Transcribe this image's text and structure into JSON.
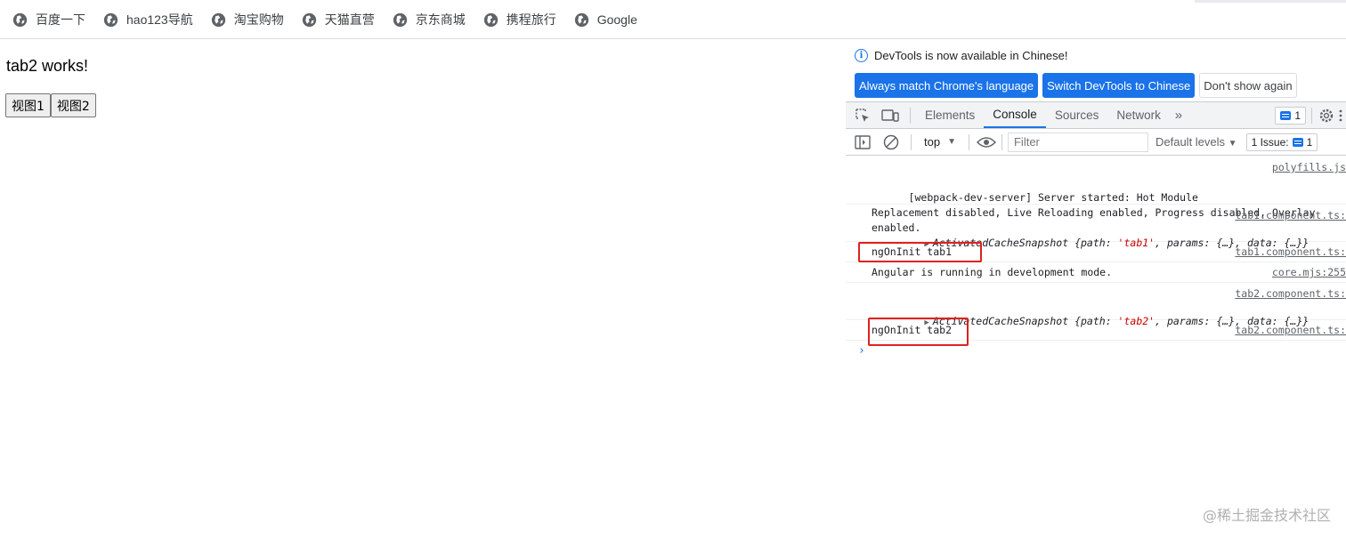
{
  "bookmarks": [
    {
      "label": "百度一下"
    },
    {
      "label": "hao123导航"
    },
    {
      "label": "淘宝购物"
    },
    {
      "label": "天猫直营"
    },
    {
      "label": "京东商城"
    },
    {
      "label": "携程旅行"
    },
    {
      "label": "Google"
    }
  ],
  "page": {
    "title": "tab2 works!",
    "buttons": [
      "视图1",
      "视图2"
    ]
  },
  "devtools": {
    "info_message": "DevTools is now available in Chinese!",
    "lang_buttons": {
      "always_match": "Always match Chrome's language",
      "switch": "Switch DevTools to Chinese",
      "dont_show": "Don't show again"
    },
    "tabs": [
      "Elements",
      "Console",
      "Sources",
      "Network"
    ],
    "active_tab": "Console",
    "messages_badge": "1",
    "context": "top",
    "filter_placeholder": "Filter",
    "levels": "Default levels",
    "issues": {
      "label": "1 Issue:",
      "count": "1"
    },
    "console_messages": [
      {
        "text": "[webpack-dev-server] Server started: Hot Module\nReplacement disabled, Live Reloading enabled, Progress disabled, Overlay\nenabled.",
        "source": "polyfills.js"
      },
      {
        "object_type": "ActivatedCacheSnapshot",
        "object_body_1": "{path: ",
        "path": "'tab1'",
        "object_body_2": ", params: {…}, data: {…}}",
        "source": "tab1.component.ts:"
      },
      {
        "text": "ngOnInit tab1",
        "source": "tab1.component.ts:",
        "highlighted": true
      },
      {
        "text": "Angular is running in development mode.",
        "source": "core.mjs:255"
      },
      {
        "object_type": "ActivatedCacheSnapshot",
        "object_body_1": "{path: ",
        "path": "'tab2'",
        "object_body_2": ", params: {…}, data: {…}}",
        "source": "tab2.component.ts:"
      },
      {
        "text": "ngOnInit tab2",
        "source": "tab2.component.ts:",
        "highlighted": true
      }
    ],
    "highlight_color": "#e0201d"
  },
  "watermark": "@稀土掘金技术社区"
}
